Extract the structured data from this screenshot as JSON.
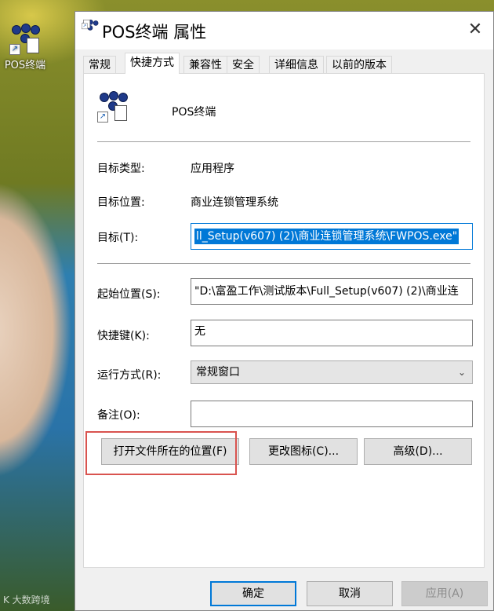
{
  "desktop": {
    "icon_label": "POS终端",
    "watermark": "K 大数跨境"
  },
  "window": {
    "title": "POS终端 属性",
    "close_glyph": "✕"
  },
  "tabs": [
    {
      "label": "常规"
    },
    {
      "label": "快捷方式"
    },
    {
      "label": "兼容性"
    },
    {
      "label": "安全"
    },
    {
      "label": "详细信息"
    },
    {
      "label": "以前的版本"
    }
  ],
  "shortcut": {
    "name": "POS终端",
    "target_type_label": "目标类型:",
    "target_type_value": "应用程序",
    "target_location_label": "目标位置:",
    "target_location_value": "商业连锁管理系统",
    "target_label": "目标(T):",
    "target_value": "ll_Setup(v607) (2)\\商业连锁管理系统\\FWPOS.exe\"",
    "start_in_label": "起始位置(S):",
    "start_in_value": "\"D:\\富盈工作\\测试版本\\Full_Setup(v607) (2)\\商业连",
    "hotkey_label": "快捷键(K):",
    "hotkey_value": "无",
    "run_label": "运行方式(R):",
    "run_value": "常规窗口",
    "comment_label": "备注(O):",
    "comment_value": ""
  },
  "buttons": {
    "open_location": "打开文件所在的位置(F)",
    "change_icon": "更改图标(C)...",
    "advanced": "高级(D)..."
  },
  "footer": {
    "ok": "确定",
    "cancel": "取消",
    "apply": "应用(A)"
  },
  "colors": {
    "accent": "#0078d7",
    "highlight_box": "#d9534f"
  }
}
